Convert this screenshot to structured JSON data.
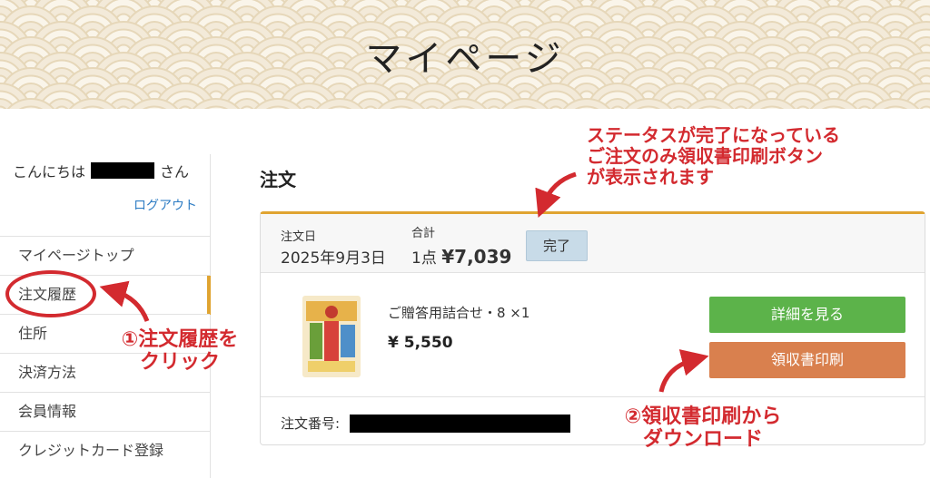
{
  "header": {
    "title": "マイページ"
  },
  "sidebar": {
    "greeting_prefix": "こんにちは",
    "greeting_suffix": "さん",
    "logout": "ログアウト",
    "items": [
      {
        "label": "マイページトップ"
      },
      {
        "label": "注文履歴"
      },
      {
        "label": "住所"
      },
      {
        "label": "決済方法"
      },
      {
        "label": "会員情報"
      },
      {
        "label": "クレジットカード登録"
      }
    ]
  },
  "main": {
    "title": "注文",
    "order": {
      "date_label": "注文日",
      "date_value": "2025年9月3日",
      "total_label": "合計",
      "total_count": "1点 ",
      "total_amount": "¥7,039",
      "status": "完了",
      "product_name": "ご贈答用詰合せ・8 ×1",
      "product_price": "¥ 5,550",
      "detail_button": "詳細を見る",
      "receipt_button": "領収書印刷",
      "order_number_label": "注文番号:"
    }
  },
  "annotations": {
    "status_note_line1": "ステータスが完了になっている",
    "status_note_line2": "ご注文のみ領収書印刷ボタン",
    "status_note_line3": "が表示されます",
    "step1_line1": "①注文履歴を",
    "step1_line2": "クリック",
    "step2_line1": "②領収書印刷から",
    "step2_line2": "ダウンロード"
  },
  "colors": {
    "accent": "#e0a431",
    "annotation": "#d32a2f",
    "detail_button": "#5cb34a",
    "receipt_button": "#d9804e",
    "status_badge": "#c8dbe8",
    "link": "#2f7dc4"
  }
}
